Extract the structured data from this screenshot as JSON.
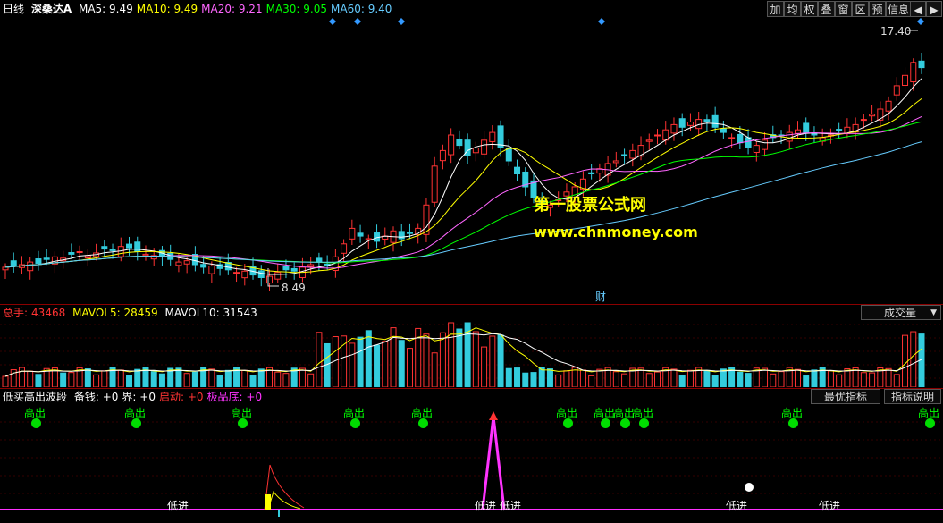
{
  "header": {
    "period": "日线",
    "stock_name": "深桑达A",
    "ma": [
      {
        "label": "MA5: 9.49",
        "color": "#ffffff"
      },
      {
        "label": "MA10: 9.49",
        "color": "#ffff00"
      },
      {
        "label": "MA20: 9.21",
        "color": "#ff66ff"
      },
      {
        "label": "MA30: 9.05",
        "color": "#00ff00"
      },
      {
        "label": "MA60: 9.40",
        "color": "#66ccff"
      }
    ]
  },
  "toolbar": [
    "加",
    "均",
    "权",
    "叠",
    "窗",
    "区",
    "预",
    "信息",
    "◀",
    "▶"
  ],
  "price_panel": {
    "high_label": "17.40",
    "low_label": "8.49",
    "marker_cai": "财",
    "watermark_title": "第一股票公式网",
    "watermark_url": "www.chnmoney.com"
  },
  "volume_panel": {
    "total_label": "总手:",
    "total_value": "43468",
    "mavol5": "MAVOL5: 28459",
    "mavol10": "MAVOL10: 31543",
    "selector": "成交量",
    "selector_arrow": "▼"
  },
  "indicator_panel": {
    "name": "低买高出波段",
    "items": [
      {
        "label": "备钱: +0",
        "color": "#ffffff"
      },
      {
        "label": "界: +0",
        "color": "#ffffff"
      },
      {
        "label": "启动: +0",
        "color": "#ff3333"
      },
      {
        "label": "极品底: +0",
        "color": "#ff33ff"
      }
    ],
    "btn_best": "最优指标",
    "btn_help": "指标说明",
    "sell_label": "高出",
    "buy_label": "低进"
  },
  "chart_data": {
    "type": "candlestick",
    "price_range": [
      8.0,
      18.0
    ],
    "closes": [
      8.9,
      8.95,
      9.0,
      9.1,
      9.05,
      9.2,
      9.3,
      9.25,
      9.4,
      9.5,
      9.35,
      9.45,
      9.6,
      9.55,
      9.7,
      9.65,
      9.5,
      9.4,
      9.35,
      9.3,
      9.2,
      9.1,
      9.15,
      9.0,
      8.9,
      8.95,
      8.85,
      8.8,
      8.7,
      8.75,
      8.6,
      8.5,
      8.55,
      8.7,
      8.8,
      8.75,
      8.9,
      9.0,
      9.1,
      9.0,
      9.3,
      9.8,
      10.4,
      10.1,
      10.0,
      9.9,
      10.1,
      10.3,
      10.0,
      10.2,
      10.4,
      11.3,
      12.8,
      13.4,
      14.0,
      13.6,
      13.2,
      13.5,
      13.8,
      14.1,
      13.5,
      13.0,
      12.5,
      12.0,
      11.6,
      11.4,
      11.3,
      11.5,
      11.8,
      12.0,
      12.3,
      12.5,
      12.7,
      12.9,
      13.0,
      13.2,
      13.4,
      13.6,
      13.8,
      14.0,
      14.2,
      14.4,
      14.3,
      14.5,
      14.6,
      14.5,
      14.3,
      14.1,
      13.9,
      13.7,
      13.5,
      13.6,
      13.8,
      13.9,
      14.0,
      14.1,
      14.2,
      14.1,
      14.0,
      13.9,
      14.0,
      14.2,
      14.3,
      14.4,
      14.6,
      14.8,
      15.0,
      15.3,
      15.9,
      16.3,
      16.8,
      16.6
    ],
    "high_value": 17.4,
    "low_value": 8.49,
    "sell_signal_x": [
      40,
      152,
      271,
      397,
      473,
      635,
      677,
      699,
      720,
      887,
      1040
    ],
    "buy_signal_x": [
      200,
      544,
      572,
      825,
      929
    ]
  }
}
